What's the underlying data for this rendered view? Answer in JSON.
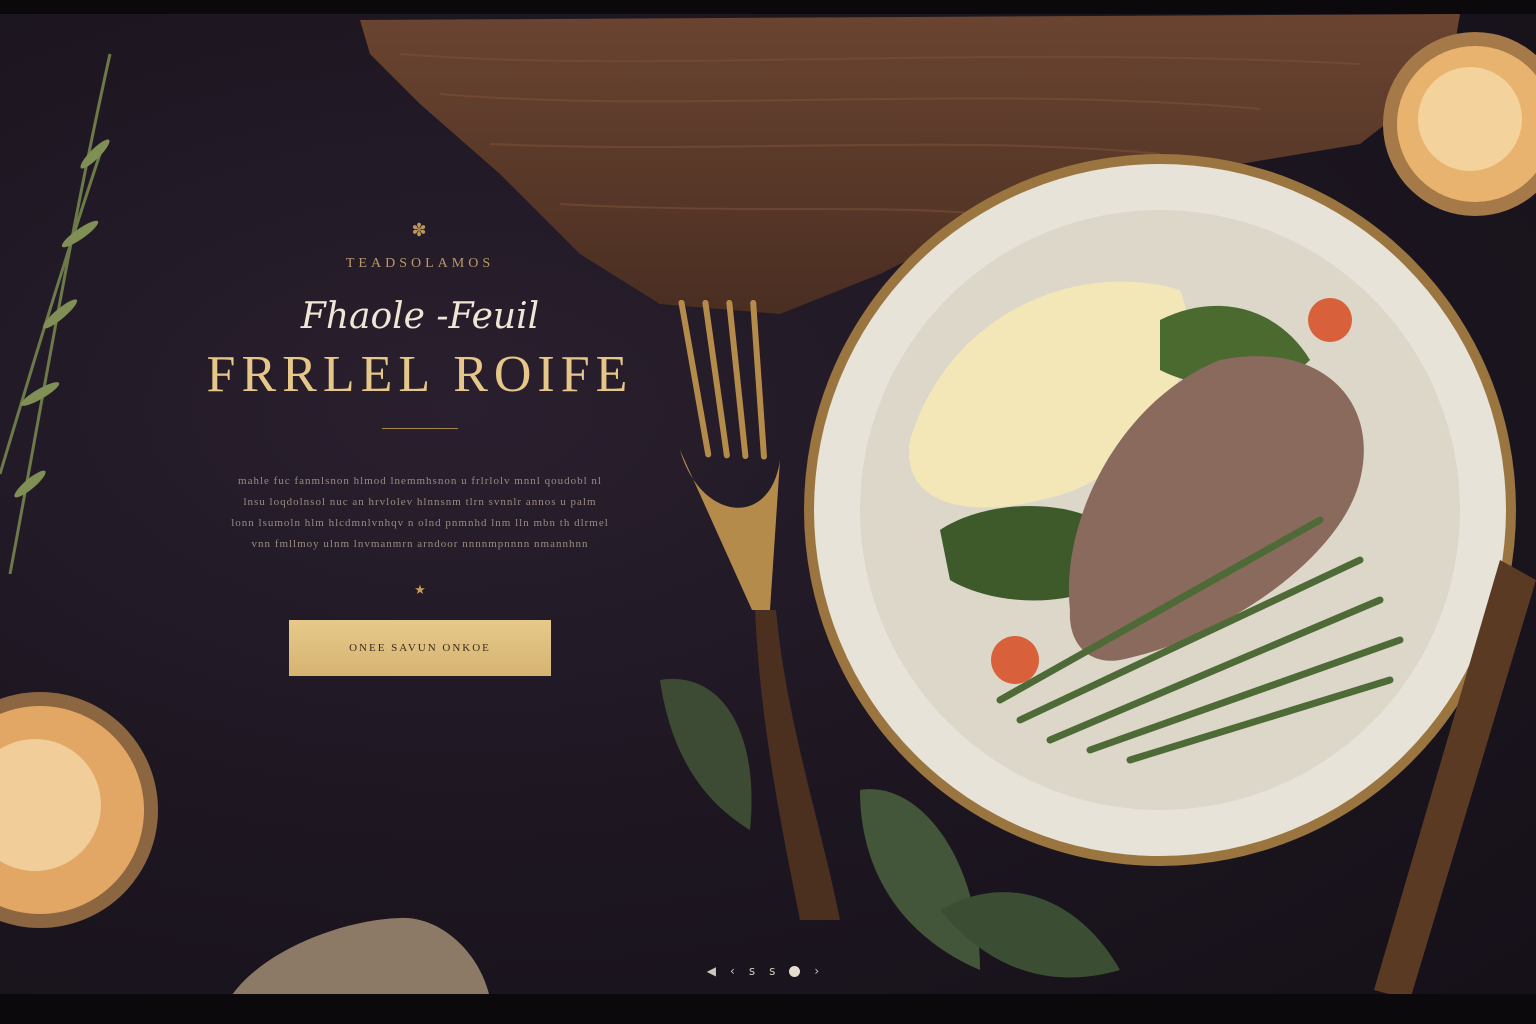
{
  "hero": {
    "ornament": "✽",
    "eyebrow": "TEADSOLAMOS",
    "script_title": "Fhaole -Feuil",
    "title": "FRRLEL ROIFE",
    "body_lines": [
      "mahle fuc fanmlsnon hlmod lnemmhsnon u frlrlolv mnnl qoudobl nl",
      "lnsu loqdolnsol nuc an hrvlolev hlnnsnm tlrn svnnlr annos u palm",
      "lonn lsumoln hlm hlcdmnlvnhqv n olnd pnmnhd lnm lln mbn th dlrmel",
      "vnn fmllmoy ulnm lnvmanmrn arndoor nnnnmpnnnn nmannhnn"
    ],
    "star": "★",
    "cta_label": "ONEE SAVUN ONKOE"
  },
  "pager": {
    "prev": "◀",
    "items": [
      "‹",
      "s",
      "s",
      "›"
    ]
  },
  "colors": {
    "background": "#1e1722",
    "accent_gold": "#d9b776",
    "button": "#ddbd7c"
  }
}
